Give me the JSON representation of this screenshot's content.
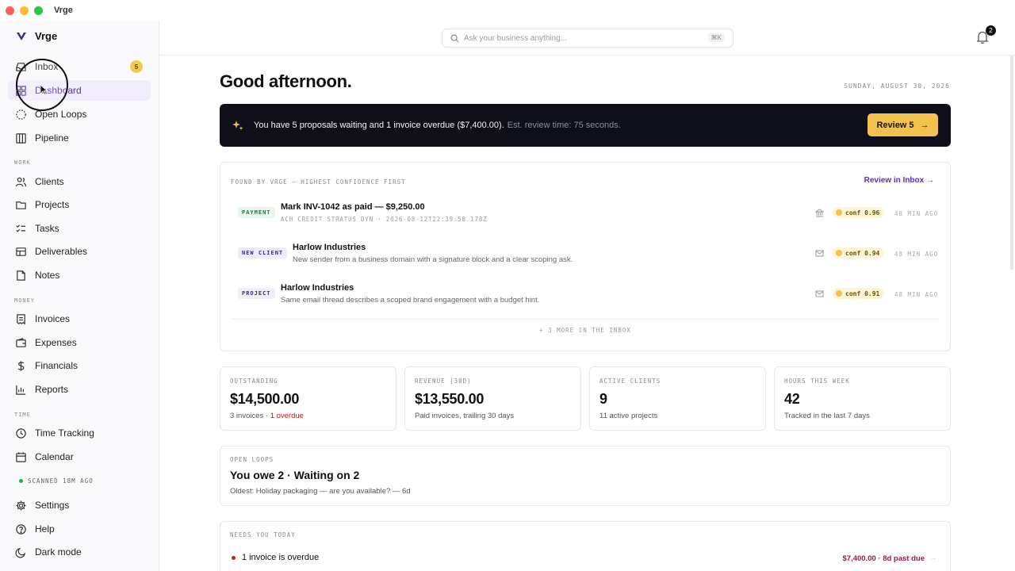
{
  "window": {
    "title": "Vrge"
  },
  "sidebar": {
    "brand": "Vrge",
    "primary": [
      {
        "label": "Inbox",
        "icon": "inbox-icon",
        "badge": "5"
      },
      {
        "label": "Dashboard",
        "icon": "grid-icon",
        "active": true
      },
      {
        "label": "Open Loops",
        "icon": "loop-icon"
      },
      {
        "label": "Pipeline",
        "icon": "pipeline-icon"
      }
    ],
    "work_label": "WORK",
    "work": [
      {
        "label": "Clients",
        "icon": "users-icon"
      },
      {
        "label": "Projects",
        "icon": "folder-icon"
      },
      {
        "label": "Tasks",
        "icon": "tasks-icon"
      },
      {
        "label": "Deliverables",
        "icon": "package-icon"
      },
      {
        "label": "Notes",
        "icon": "note-icon"
      }
    ],
    "money_label": "MONEY",
    "money": [
      {
        "label": "Invoices",
        "icon": "invoice-icon"
      },
      {
        "label": "Expenses",
        "icon": "wallet-icon"
      },
      {
        "label": "Financials",
        "icon": "dollar-icon"
      },
      {
        "label": "Reports",
        "icon": "report-icon"
      }
    ],
    "time_label": "TIME",
    "time": [
      {
        "label": "Time Tracking",
        "icon": "clock-icon"
      },
      {
        "label": "Calendar",
        "icon": "calendar-icon"
      }
    ],
    "scanned": "SCANNED 18M AGO",
    "footer": [
      {
        "label": "Settings",
        "icon": "gear-icon"
      },
      {
        "label": "Help",
        "icon": "help-icon"
      },
      {
        "label": "Dark mode",
        "icon": "moon-icon"
      }
    ]
  },
  "topbar": {
    "search_placeholder": "Ask your business anything...",
    "search_shortcut": "⌘K",
    "notification_count": "2"
  },
  "main": {
    "greeting": "Good afternoon.",
    "date": "SUNDAY, AUGUST 30, 2026",
    "banner": {
      "message": "You have 5 proposals waiting and 1 invoice overdue ($7,400.00).",
      "sub": "Est. review time: 75 seconds.",
      "button": "Review 5"
    },
    "found": {
      "label": "FOUND BY VRGE — HIGHEST CONFIDENCE FIRST",
      "link": "Review in Inbox →",
      "items": [
        {
          "tag": "PAYMENT",
          "title": "Mark INV-1042 as paid — $9,250.00",
          "sub": "ACH CREDIT STRATUS DYN · 2026-08-12T22:39:58.178Z",
          "icon": "bank-icon",
          "conf": "conf 0.96",
          "ago": "48 MIN AGO"
        },
        {
          "tag": "NEW CLIENT",
          "title": "Harlow Industries",
          "sub": "New sender from a business domain with a signature block and a clear scoping ask.",
          "icon": "mail-icon",
          "conf": "conf 0.94",
          "ago": "48 MIN AGO"
        },
        {
          "tag": "PROJECT",
          "title": "Harlow Industries",
          "sub": "Same email thread describes a scoped brand engagement with a budget hint.",
          "icon": "mail-icon",
          "conf": "conf 0.91",
          "ago": "48 MIN AGO"
        }
      ],
      "more": "+ 3 MORE IN THE INBOX"
    },
    "stats": [
      {
        "label": "OUTSTANDING",
        "value": "$14,500.00",
        "sub": "3 invoices · ",
        "sub_alert": "1 overdue"
      },
      {
        "label": "REVENUE (30D)",
        "value": "$13,550.00",
        "sub": "Paid invoices, trailing 30 days"
      },
      {
        "label": "ACTIVE CLIENTS",
        "value": "9",
        "sub": "11 active projects"
      },
      {
        "label": "HOURS THIS WEEK",
        "value": "42",
        "sub": "Tracked in the last 7 days"
      }
    ],
    "open_loops": {
      "label": "OPEN LOOPS",
      "title": "You owe 2 · Waiting on 2",
      "sub": "Oldest: Holiday packaging — are you available? — 6d"
    },
    "needs_you": {
      "label": "NEEDS YOU TODAY",
      "item": "1 invoice is overdue",
      "amount": "$7,400.00 · 8d past due"
    }
  }
}
